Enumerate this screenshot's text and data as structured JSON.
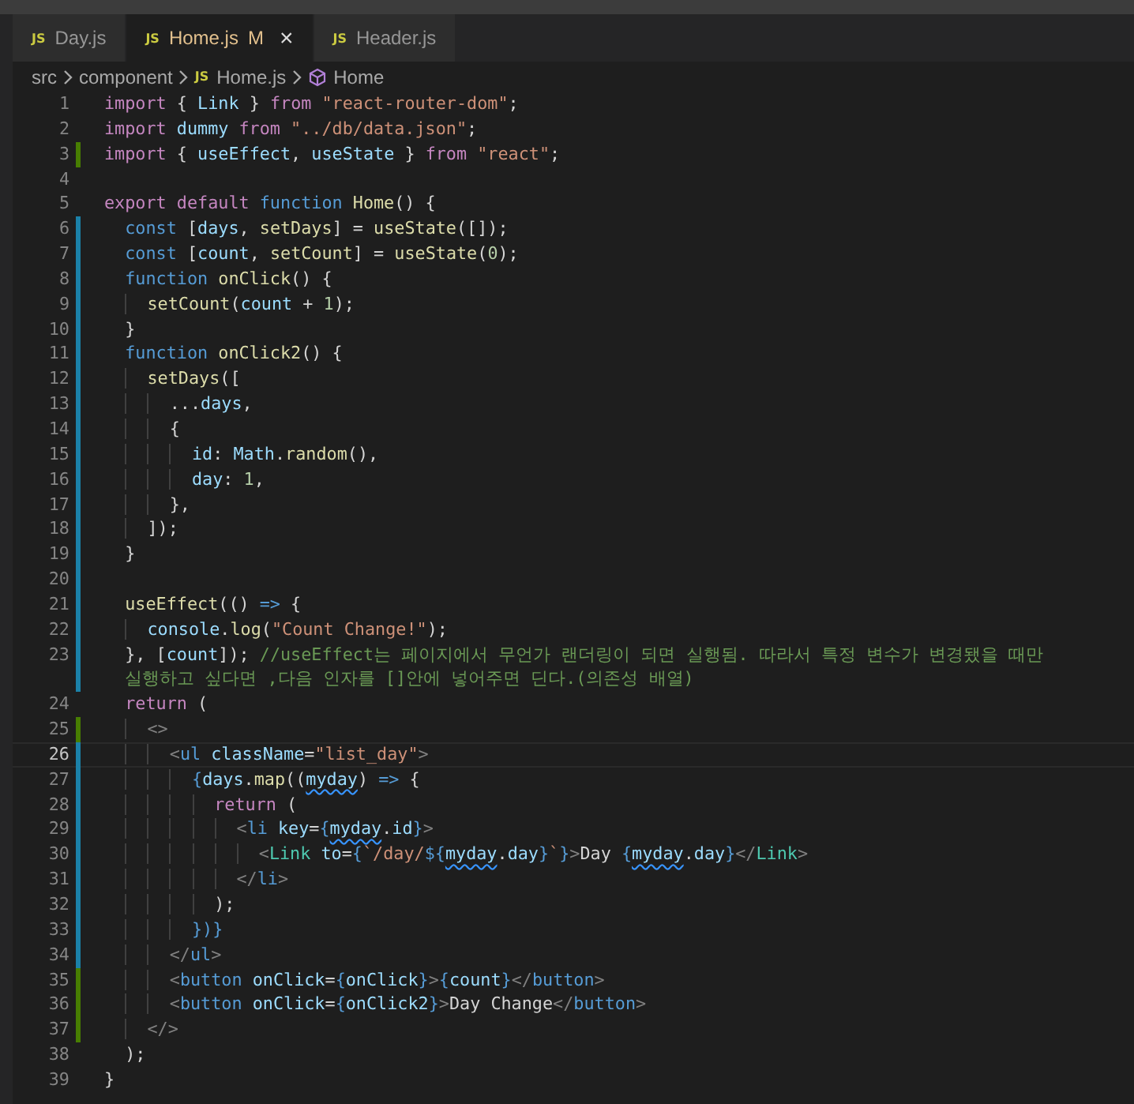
{
  "tabs": [
    {
      "icon": "JS",
      "label": "Day.js",
      "selected": false
    },
    {
      "icon": "JS",
      "label": "Home.js",
      "status": "M",
      "close": "×",
      "selected": true
    },
    {
      "icon": "JS",
      "label": "Header.js",
      "selected": false
    }
  ],
  "breadcrumbs": [
    {
      "kind": "folder",
      "label": "src"
    },
    {
      "kind": "folder",
      "label": "component"
    },
    {
      "kind": "file",
      "icon": "JS",
      "label": "Home.js"
    },
    {
      "kind": "symbol",
      "label": "Home"
    }
  ],
  "lines": [
    {
      "number": "1",
      "added": false,
      "modified": false,
      "current": false,
      "tokens": [
        {
          "text": "import ",
          "kind": "keyword"
        },
        {
          "text": "{ ",
          "kind": "punct"
        },
        {
          "text": "Link ",
          "kind": "variable"
        },
        {
          "text": "} ",
          "kind": "punct"
        },
        {
          "text": "from ",
          "kind": "keyword"
        },
        {
          "text": "\"react-router-dom\"",
          "kind": "string"
        },
        {
          "text": ";",
          "kind": "punct"
        }
      ]
    },
    {
      "number": "2",
      "added": false,
      "modified": false,
      "current": false,
      "tokens": [
        {
          "text": "import ",
          "kind": "keyword"
        },
        {
          "text": "dummy ",
          "kind": "variable"
        },
        {
          "text": "from ",
          "kind": "keyword"
        },
        {
          "text": "\"../db/data.json\"",
          "kind": "string"
        },
        {
          "text": ";",
          "kind": "punct"
        }
      ]
    },
    {
      "number": "3",
      "added": true,
      "modified": false,
      "current": false,
      "tokens": [
        {
          "text": "import ",
          "kind": "keyword"
        },
        {
          "text": "{ ",
          "kind": "punct"
        },
        {
          "text": "useEffect",
          "kind": "variable"
        },
        {
          "text": ", ",
          "kind": "punct"
        },
        {
          "text": "useState ",
          "kind": "variable"
        },
        {
          "text": "} ",
          "kind": "punct"
        },
        {
          "text": "from ",
          "kind": "keyword"
        },
        {
          "text": "\"react\"",
          "kind": "string"
        },
        {
          "text": ";",
          "kind": "punct"
        }
      ]
    },
    {
      "number": "4",
      "added": false,
      "modified": false,
      "current": false
    },
    {
      "number": "5",
      "added": false,
      "modified": false,
      "current": false,
      "tokens": [
        {
          "text": "export ",
          "kind": "keyword"
        },
        {
          "text": "default ",
          "kind": "keyword"
        },
        {
          "text": "function ",
          "kind": "storage"
        },
        {
          "text": "Home",
          "kind": "function"
        },
        {
          "text": "() {",
          "kind": "punct"
        }
      ]
    },
    {
      "number": "6",
      "added": false,
      "modified": true,
      "current": false,
      "tokens": [
        {
          "text": "  const ",
          "kind": "storage"
        },
        {
          "text": "[",
          "kind": "punct"
        },
        {
          "text": "days",
          "kind": "variable"
        },
        {
          "text": ", ",
          "kind": "punct"
        },
        {
          "text": "setDays",
          "kind": "function"
        },
        {
          "text": "] = ",
          "kind": "punct"
        },
        {
          "text": "useState",
          "kind": "function"
        },
        {
          "text": "([]);",
          "kind": "punct"
        }
      ]
    },
    {
      "number": "7",
      "added": false,
      "modified": true,
      "current": false,
      "tokens": [
        {
          "text": "  const ",
          "kind": "storage"
        },
        {
          "text": "[",
          "kind": "punct"
        },
        {
          "text": "count",
          "kind": "variable"
        },
        {
          "text": ", ",
          "kind": "punct"
        },
        {
          "text": "setCount",
          "kind": "function"
        },
        {
          "text": "] = ",
          "kind": "punct"
        },
        {
          "text": "useState",
          "kind": "function"
        },
        {
          "text": "(",
          "kind": "punct"
        },
        {
          "text": "0",
          "kind": "number"
        },
        {
          "text": ");",
          "kind": "punct"
        }
      ]
    },
    {
      "number": "8",
      "added": false,
      "modified": true,
      "current": false,
      "tokens": [
        {
          "text": "  function ",
          "kind": "storage"
        },
        {
          "text": "onClick",
          "kind": "function"
        },
        {
          "text": "() {",
          "kind": "punct"
        }
      ]
    },
    {
      "number": "9",
      "added": false,
      "modified": true,
      "current": false,
      "tokens": [
        {
          "text": "    setCount",
          "kind": "function"
        },
        {
          "text": "(",
          "kind": "punct"
        },
        {
          "text": "count",
          "kind": "variable"
        },
        {
          "text": " + ",
          "kind": "punct"
        },
        {
          "text": "1",
          "kind": "number"
        },
        {
          "text": ");",
          "kind": "punct"
        }
      ]
    },
    {
      "number": "10",
      "added": false,
      "modified": true,
      "current": false,
      "tokens": [
        {
          "text": "  }",
          "kind": "punct"
        }
      ]
    },
    {
      "number": "11",
      "added": false,
      "modified": true,
      "current": false,
      "tokens": [
        {
          "text": "  function ",
          "kind": "storage"
        },
        {
          "text": "onClick2",
          "kind": "function"
        },
        {
          "text": "() {",
          "kind": "punct"
        }
      ]
    },
    {
      "number": "12",
      "added": false,
      "modified": true,
      "current": false,
      "tokens": [
        {
          "text": "    setDays",
          "kind": "function"
        },
        {
          "text": "([",
          "kind": "punct"
        }
      ]
    },
    {
      "number": "13",
      "added": false,
      "modified": true,
      "current": false,
      "tokens": [
        {
          "text": "      ...",
          "kind": "punct"
        },
        {
          "text": "days",
          "kind": "variable"
        },
        {
          "text": ",",
          "kind": "punct"
        }
      ]
    },
    {
      "number": "14",
      "added": false,
      "modified": true,
      "current": false,
      "tokens": [
        {
          "text": "      {",
          "kind": "punct"
        }
      ]
    },
    {
      "number": "15",
      "added": false,
      "modified": true,
      "current": false,
      "tokens": [
        {
          "text": "        id",
          "kind": "variable"
        },
        {
          "text": ": ",
          "kind": "punct"
        },
        {
          "text": "Math",
          "kind": "variable"
        },
        {
          "text": ".",
          "kind": "punct"
        },
        {
          "text": "random",
          "kind": "function"
        },
        {
          "text": "(),",
          "kind": "punct"
        }
      ]
    },
    {
      "number": "16",
      "added": false,
      "modified": true,
      "current": false,
      "tokens": [
        {
          "text": "        day",
          "kind": "variable"
        },
        {
          "text": ": ",
          "kind": "punct"
        },
        {
          "text": "1",
          "kind": "number"
        },
        {
          "text": ",",
          "kind": "punct"
        }
      ]
    },
    {
      "number": "17",
      "added": false,
      "modified": true,
      "current": false,
      "tokens": [
        {
          "text": "      },",
          "kind": "punct"
        }
      ]
    },
    {
      "number": "18",
      "added": false,
      "modified": true,
      "current": false,
      "tokens": [
        {
          "text": "    ]);",
          "kind": "punct"
        }
      ]
    },
    {
      "number": "19",
      "added": false,
      "modified": true,
      "current": false,
      "tokens": [
        {
          "text": "  }",
          "kind": "punct"
        }
      ]
    },
    {
      "number": "20",
      "added": false,
      "modified": true,
      "current": false
    },
    {
      "number": "21",
      "added": false,
      "modified": true,
      "current": false,
      "tokens": [
        {
          "text": "  useEffect",
          "kind": "function"
        },
        {
          "text": "(() ",
          "kind": "punct"
        },
        {
          "text": "=>",
          "kind": "storage"
        },
        {
          "text": " {",
          "kind": "punct"
        }
      ]
    },
    {
      "number": "22",
      "added": false,
      "modified": true,
      "current": false,
      "tokens": [
        {
          "text": "    console",
          "kind": "variable"
        },
        {
          "text": ".",
          "kind": "punct"
        },
        {
          "text": "log",
          "kind": "function"
        },
        {
          "text": "(",
          "kind": "punct"
        },
        {
          "text": "\"Count Change!\"",
          "kind": "string"
        },
        {
          "text": ");",
          "kind": "punct"
        }
      ]
    },
    {
      "number": "23",
      "added": false,
      "modified": true,
      "current": false,
      "tokens": [
        {
          "text": "  }, [",
          "kind": "punct"
        },
        {
          "text": "count",
          "kind": "variable"
        },
        {
          "text": "]); ",
          "kind": "punct"
        },
        {
          "text": "//useEffect는 페이지에서 무언가 랜더링이 되면 실행됨. 따라서 특정 변수가 변경됐을 때만",
          "kind": "comment"
        }
      ],
      "continuation": [
        {
          "text": "실행하고 싶다면 ,다음 인자를 []안에 넣어주면 딘다.(의존성 배열)",
          "kind": "comment"
        }
      ]
    },
    {
      "number": "24",
      "added": false,
      "modified": false,
      "current": false,
      "tokens": [
        {
          "text": "  return ",
          "kind": "keyword"
        },
        {
          "text": "(",
          "kind": "punct"
        }
      ]
    },
    {
      "number": "25",
      "added": true,
      "modified": false,
      "current": false,
      "tokens": [
        {
          "text": "    <>",
          "kind": "tag"
        }
      ]
    },
    {
      "number": "26",
      "added": false,
      "modified": true,
      "current": true,
      "tokens": [
        {
          "text": "      <",
          "kind": "tag"
        },
        {
          "text": "ul ",
          "kind": "element"
        },
        {
          "text": "className",
          "kind": "attribute"
        },
        {
          "text": "=",
          "kind": "punct"
        },
        {
          "text": "\"list_day\"",
          "kind": "string"
        },
        {
          "text": ">",
          "kind": "tag"
        }
      ]
    },
    {
      "number": "27",
      "added": false,
      "modified": true,
      "current": false,
      "tokens": [
        {
          "text": "        {",
          "kind": "storage"
        },
        {
          "text": "days",
          "kind": "variable"
        },
        {
          "text": ".",
          "kind": "punct"
        },
        {
          "text": "map",
          "kind": "function"
        },
        {
          "text": "((",
          "kind": "punct"
        },
        {
          "text": "myday",
          "kind": "warning"
        },
        {
          "text": ") ",
          "kind": "punct"
        },
        {
          "text": "=>",
          "kind": "storage"
        },
        {
          "text": " {",
          "kind": "punct"
        }
      ]
    },
    {
      "number": "28",
      "added": false,
      "modified": true,
      "current": false,
      "tokens": [
        {
          "text": "          return ",
          "kind": "keyword"
        },
        {
          "text": "(",
          "kind": "punct"
        }
      ]
    },
    {
      "number": "29",
      "added": false,
      "modified": true,
      "current": false,
      "tokens": [
        {
          "text": "            <",
          "kind": "tag"
        },
        {
          "text": "li ",
          "kind": "element"
        },
        {
          "text": "key",
          "kind": "attribute"
        },
        {
          "text": "=",
          "kind": "punct"
        },
        {
          "text": "{",
          "kind": "storage"
        },
        {
          "text": "myday",
          "kind": "warning"
        },
        {
          "text": ".",
          "kind": "punct"
        },
        {
          "text": "id",
          "kind": "variable"
        },
        {
          "text": "}",
          "kind": "storage"
        },
        {
          "text": ">",
          "kind": "tag"
        }
      ]
    },
    {
      "number": "30",
      "added": false,
      "modified": true,
      "current": false,
      "tokens": [
        {
          "text": "              <",
          "kind": "tag"
        },
        {
          "text": "Link ",
          "kind": "component"
        },
        {
          "text": "to",
          "kind": "attribute"
        },
        {
          "text": "=",
          "kind": "punct"
        },
        {
          "text": "{",
          "kind": "storage"
        },
        {
          "text": "`/day/",
          "kind": "string"
        },
        {
          "text": "${",
          "kind": "storage"
        },
        {
          "text": "myday",
          "kind": "warning"
        },
        {
          "text": ".",
          "kind": "punct"
        },
        {
          "text": "day",
          "kind": "variable"
        },
        {
          "text": "}",
          "kind": "storage"
        },
        {
          "text": "`",
          "kind": "string"
        },
        {
          "text": "}",
          "kind": "storage"
        },
        {
          "text": ">",
          "kind": "tag"
        },
        {
          "text": "Day ",
          "kind": "punct"
        },
        {
          "text": "{",
          "kind": "storage"
        },
        {
          "text": "myday",
          "kind": "warning"
        },
        {
          "text": ".",
          "kind": "punct"
        },
        {
          "text": "day",
          "kind": "variable"
        },
        {
          "text": "}",
          "kind": "storage"
        },
        {
          "text": "</",
          "kind": "tag"
        },
        {
          "text": "Link",
          "kind": "component"
        },
        {
          "text": ">",
          "kind": "tag"
        }
      ]
    },
    {
      "number": "31",
      "added": false,
      "modified": true,
      "current": false,
      "tokens": [
        {
          "text": "            </",
          "kind": "tag"
        },
        {
          "text": "li",
          "kind": "element"
        },
        {
          "text": ">",
          "kind": "tag"
        }
      ]
    },
    {
      "number": "32",
      "added": false,
      "modified": true,
      "current": false,
      "tokens": [
        {
          "text": "          );",
          "kind": "punct"
        }
      ]
    },
    {
      "number": "33",
      "added": false,
      "modified": true,
      "current": false,
      "tokens": [
        {
          "text": "        })}",
          "kind": "storage"
        }
      ]
    },
    {
      "number": "34",
      "added": false,
      "modified": true,
      "current": false,
      "tokens": [
        {
          "text": "      </",
          "kind": "tag"
        },
        {
          "text": "ul",
          "kind": "element"
        },
        {
          "text": ">",
          "kind": "tag"
        }
      ]
    },
    {
      "number": "35",
      "added": true,
      "modified": false,
      "current": false,
      "tokens": [
        {
          "text": "      <",
          "kind": "tag"
        },
        {
          "text": "button ",
          "kind": "element"
        },
        {
          "text": "onClick",
          "kind": "attribute"
        },
        {
          "text": "=",
          "kind": "punct"
        },
        {
          "text": "{",
          "kind": "storage"
        },
        {
          "text": "onClick",
          "kind": "variable"
        },
        {
          "text": "}",
          "kind": "storage"
        },
        {
          "text": ">",
          "kind": "tag"
        },
        {
          "text": "{",
          "kind": "storage"
        },
        {
          "text": "count",
          "kind": "variable"
        },
        {
          "text": "}",
          "kind": "storage"
        },
        {
          "text": "</",
          "kind": "tag"
        },
        {
          "text": "button",
          "kind": "element"
        },
        {
          "text": ">",
          "kind": "tag"
        }
      ]
    },
    {
      "number": "36",
      "added": true,
      "modified": false,
      "current": false,
      "tokens": [
        {
          "text": "      <",
          "kind": "tag"
        },
        {
          "text": "button ",
          "kind": "element"
        },
        {
          "text": "onClick",
          "kind": "attribute"
        },
        {
          "text": "=",
          "kind": "punct"
        },
        {
          "text": "{",
          "kind": "storage"
        },
        {
          "text": "onClick2",
          "kind": "variable"
        },
        {
          "text": "}",
          "kind": "storage"
        },
        {
          "text": ">",
          "kind": "tag"
        },
        {
          "text": "Day Change",
          "kind": "punct"
        },
        {
          "text": "</",
          "kind": "tag"
        },
        {
          "text": "button",
          "kind": "element"
        },
        {
          "text": ">",
          "kind": "tag"
        }
      ]
    },
    {
      "number": "37",
      "added": true,
      "modified": false,
      "current": false,
      "tokens": [
        {
          "text": "    </>",
          "kind": "tag"
        }
      ]
    },
    {
      "number": "38",
      "added": false,
      "modified": false,
      "current": false,
      "tokens": [
        {
          "text": "  );",
          "kind": "punct"
        }
      ]
    },
    {
      "number": "39",
      "added": false,
      "modified": false,
      "current": false,
      "tokens": [
        {
          "text": "}",
          "kind": "punct"
        }
      ]
    }
  ]
}
